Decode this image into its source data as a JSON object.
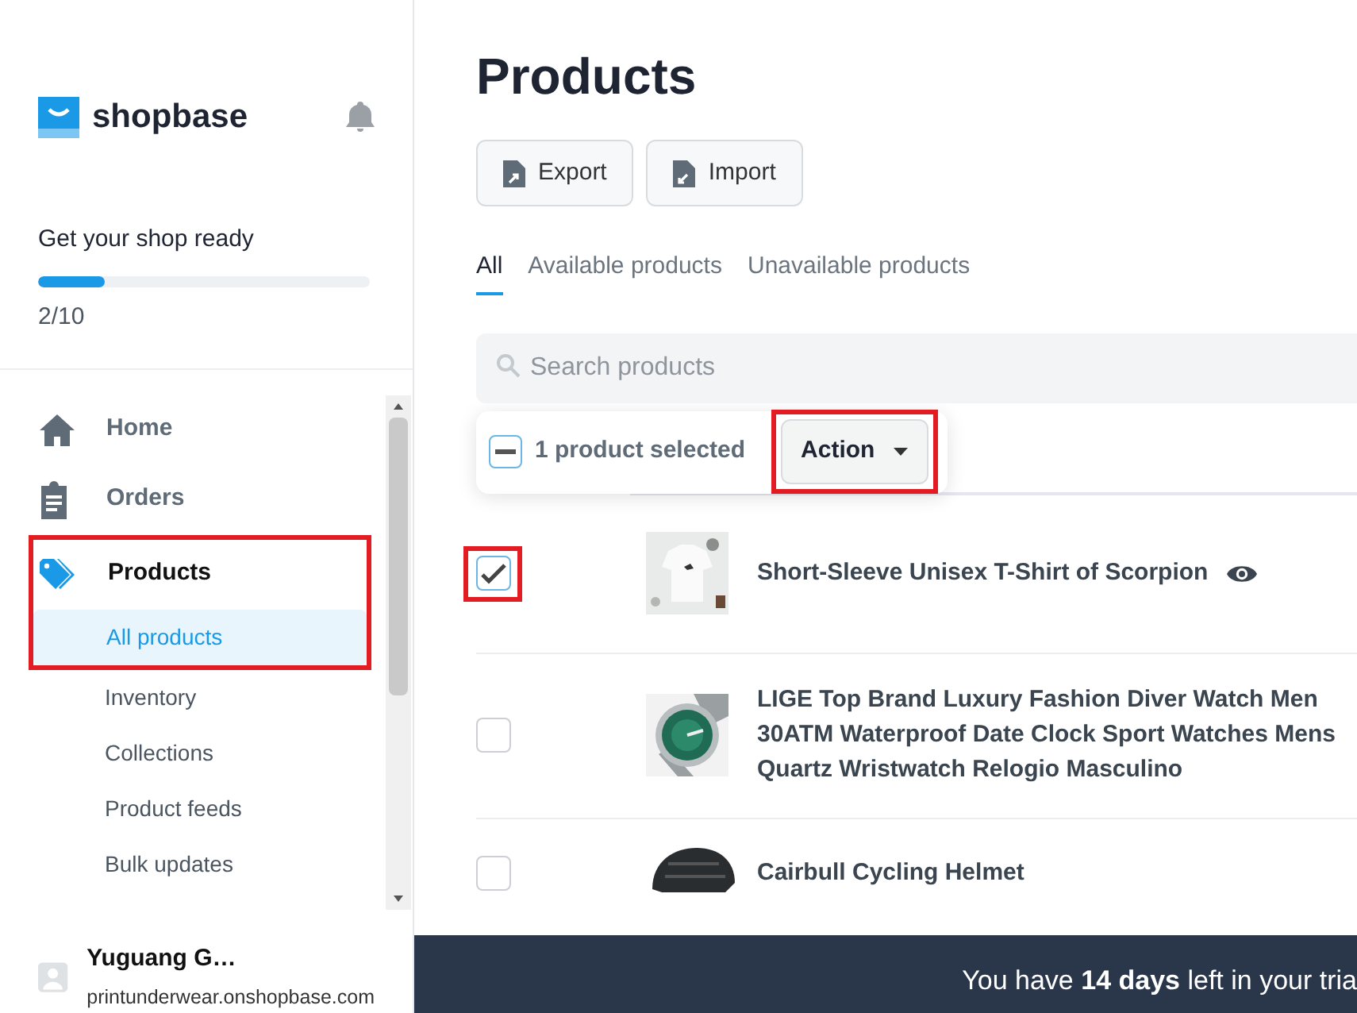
{
  "sidebar": {
    "brand": "shopbase",
    "setup": {
      "title": "Get your shop ready",
      "level": 0.2,
      "count": "2/10"
    },
    "nav": [
      {
        "label": "Home",
        "selected": false,
        "highlighted": false
      },
      {
        "label": "Orders",
        "selected": false,
        "highlighted": false
      },
      {
        "label": "Products",
        "selected": true,
        "highlighted": true,
        "children": [
          {
            "label": "All products",
            "selected": true
          },
          {
            "label": "Inventory",
            "selected": false
          },
          {
            "label": "Collections",
            "selected": false
          },
          {
            "label": "Product feeds",
            "selected": false
          },
          {
            "label": "Bulk updates",
            "selected": false
          }
        ]
      }
    ],
    "user": {
      "name": "Yuguang G…",
      "domain": "printunderwear.onshopbase.com"
    }
  },
  "page": {
    "title": "Products",
    "buttons": [
      "Export",
      "Import"
    ],
    "tabs": [
      {
        "label": "All",
        "selected": true
      },
      {
        "label": "Available products",
        "selected": false
      },
      {
        "label": "Unavailable products",
        "selected": false
      }
    ],
    "search": {
      "placeholder": "Search products"
    },
    "bulk": {
      "indeterminate": true,
      "label": "1 product selected",
      "action": "Action",
      "highlighted": true
    },
    "rows": [
      {
        "name": "Short-Sleeve Unisex T-Shirt of Scorpion",
        "checked": true,
        "highlighted": true,
        "preview": true
      },
      {
        "name": "LIGE Top Brand Luxury Fashion Diver Watch Men 30ATM Waterproof Date Clock Sport Watches Mens Quartz Wristwatch Relogio Masculino",
        "checked": false,
        "highlighted": false,
        "preview": false
      },
      {
        "name": "Cairbull Cycling Helmet",
        "checked": false,
        "highlighted": false,
        "preview": false
      }
    ]
  },
  "trial_banner": "You have **14 days** left in your tria"
}
